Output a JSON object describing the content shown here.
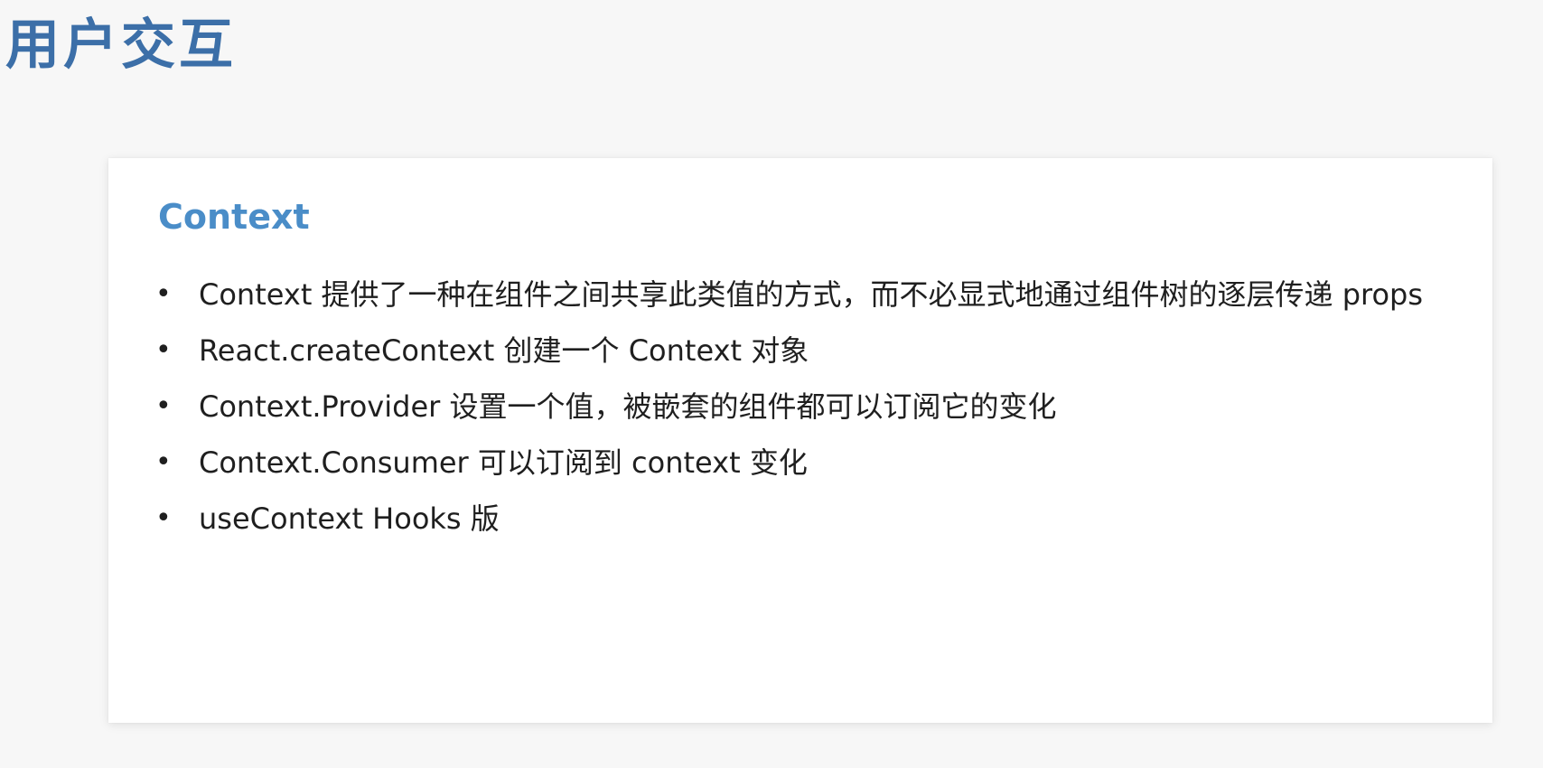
{
  "page": {
    "title": "用户交互",
    "corner_fragment": "",
    "colors": {
      "title": "#3c6fa8",
      "accent": "#4a8dc8",
      "text": "#1f1f1f",
      "background": "#f7f7f7",
      "card": "#ffffff"
    }
  },
  "card": {
    "heading": "Context",
    "bullets": [
      {
        "marker": "•",
        "text": "Context 提供了一种在组件之间共享此类值的方式，而不必显式地通过组件树的逐层传递 props"
      },
      {
        "marker": "•",
        "text": "React.createContext 创建一个 Context 对象"
      },
      {
        "marker": "•",
        "text": "Context.Provider 设置一个值，被嵌套的组件都可以订阅它的变化"
      },
      {
        "marker": "•",
        "text": "Context.Consumer 可以订阅到 context 变化"
      },
      {
        "marker": "•",
        "text": "useContext Hooks 版"
      }
    ]
  }
}
